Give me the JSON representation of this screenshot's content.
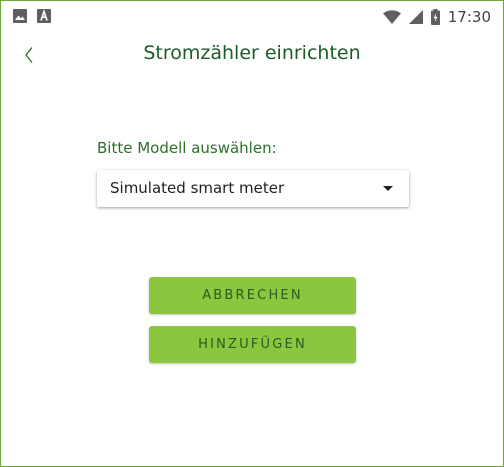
{
  "status_bar": {
    "left_icons": [
      "image-icon",
      "a-letter-icon"
    ],
    "right_icons": [
      "wifi-icon",
      "cell-signal-icon",
      "battery-icon"
    ],
    "time": "17:30"
  },
  "app_bar": {
    "back_icon": "chevron-left-icon",
    "title": "Stromzähler einrichten"
  },
  "form": {
    "model_label": "Bitte Modell auswählen:",
    "selected_model": "Simulated smart meter",
    "dropdown_icon": "triangle-down-icon"
  },
  "actions": {
    "cancel_label": "ABBRECHEN",
    "add_label": "HINZUFÜGEN"
  },
  "colors": {
    "frame_border": "#6aa636",
    "title_text": "#1e5a2a",
    "label_text": "#2f6e2d",
    "button_bg": "#8cc63f",
    "button_text": "#2d5a1e"
  }
}
